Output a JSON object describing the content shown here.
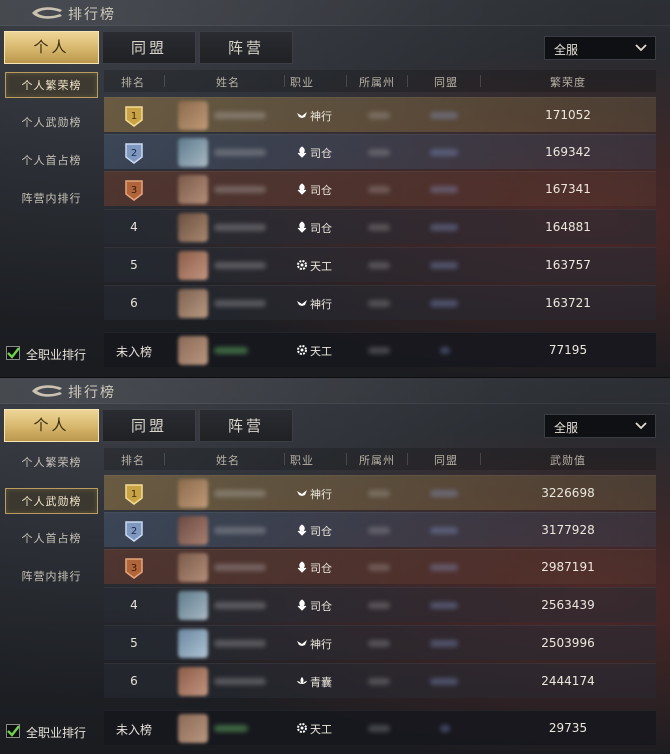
{
  "panels": [
    {
      "title": "排行榜",
      "tabs": [
        "个人",
        "同盟",
        "阵营"
      ],
      "server": "全服",
      "sidebar": [
        "个人繁荣榜",
        "个人武勋榜",
        "个人首占榜",
        "阵营内排行"
      ],
      "active_sidebar": 0,
      "columns": [
        "排名",
        "姓名",
        "职业",
        "所属州",
        "同盟",
        "繁荣度"
      ],
      "rows": [
        {
          "rank": "1",
          "class": "神行",
          "class_icon": "bird-icon",
          "value": "171052"
        },
        {
          "rank": "2",
          "class": "司仓",
          "class_icon": "grain-icon",
          "value": "169342"
        },
        {
          "rank": "3",
          "class": "司仓",
          "class_icon": "grain-icon",
          "value": "167341"
        },
        {
          "rank": "4",
          "class": "司仓",
          "class_icon": "grain-icon",
          "value": "164881"
        },
        {
          "rank": "5",
          "class": "天工",
          "class_icon": "gear-icon",
          "value": "163757"
        },
        {
          "rank": "6",
          "class": "神行",
          "class_icon": "bird-icon",
          "value": "163721"
        }
      ],
      "self_row": {
        "rank": "未入榜",
        "class": "天工",
        "class_icon": "gear-icon",
        "value": "77195"
      },
      "all_classes_label": "全职业排行"
    },
    {
      "title": "排行榜",
      "tabs": [
        "个人",
        "同盟",
        "阵营"
      ],
      "server": "全服",
      "sidebar": [
        "个人繁荣榜",
        "个人武勋榜",
        "个人首占榜",
        "阵营内排行"
      ],
      "active_sidebar": 1,
      "columns": [
        "排名",
        "姓名",
        "职业",
        "所属州",
        "同盟",
        "武勋值"
      ],
      "rows": [
        {
          "rank": "1",
          "class": "神行",
          "class_icon": "bird-icon",
          "value": "3226698"
        },
        {
          "rank": "2",
          "class": "司仓",
          "class_icon": "grain-icon",
          "value": "3177928"
        },
        {
          "rank": "3",
          "class": "司仓",
          "class_icon": "grain-icon",
          "value": "2987191"
        },
        {
          "rank": "4",
          "class": "司仓",
          "class_icon": "grain-icon",
          "value": "2563439"
        },
        {
          "rank": "5",
          "class": "神行",
          "class_icon": "bird-icon",
          "value": "2503996"
        },
        {
          "rank": "6",
          "class": "青囊",
          "class_icon": "lotus-icon",
          "value": "2444174"
        }
      ],
      "self_row": {
        "rank": "未入榜",
        "class": "天工",
        "class_icon": "gear-icon",
        "value": "29735"
      },
      "all_classes_label": "全职业排行"
    }
  ],
  "colors": {
    "tab_active": "#d6b66b",
    "rank_gold": "#c9a246",
    "rank_silver": "#7f98c0",
    "rank_bronze": "#b0643a",
    "checkbox_green": "#6fd24a"
  }
}
